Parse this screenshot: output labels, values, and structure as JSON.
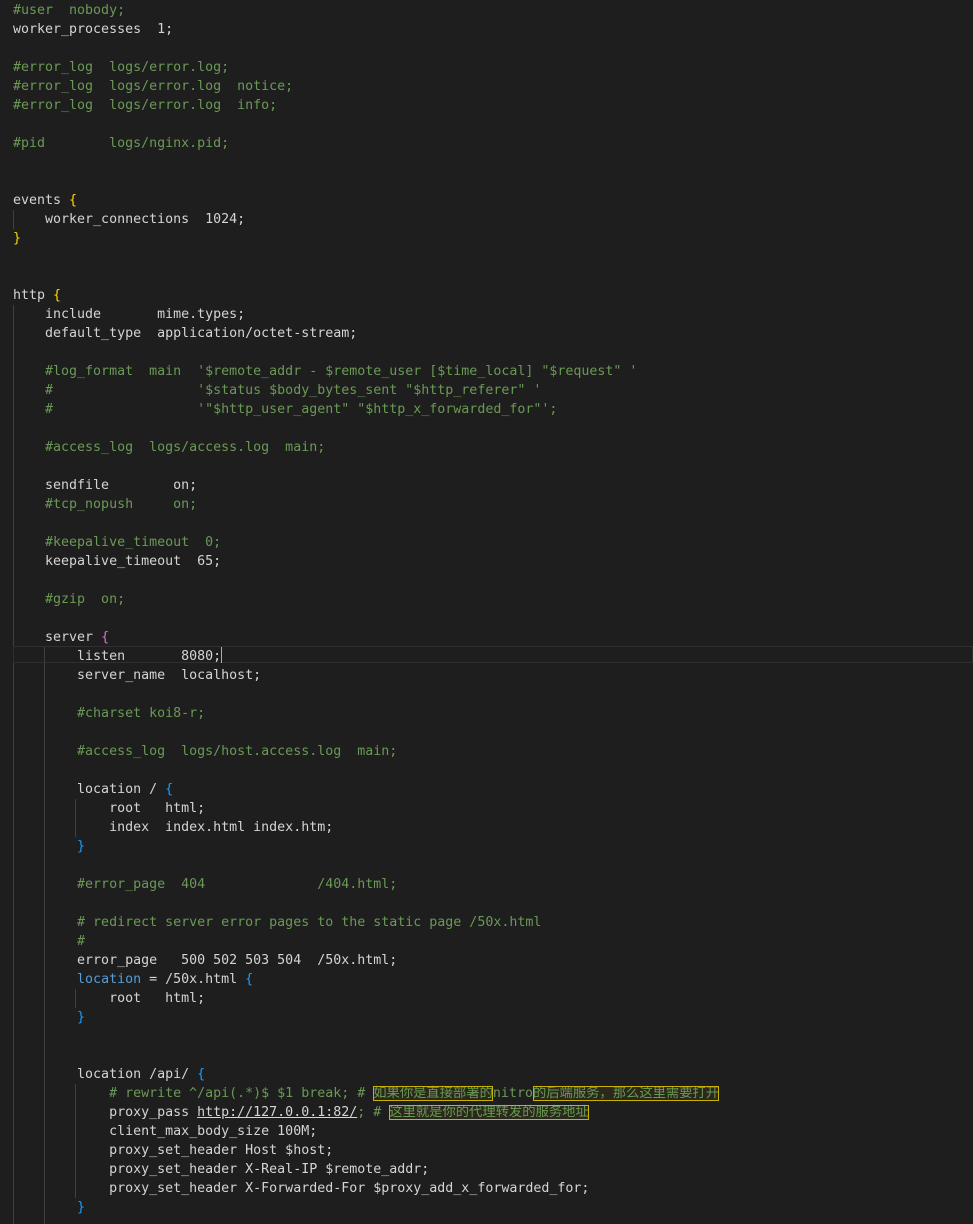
{
  "lines": {
    "l1": "#user  nobody;",
    "l2": "worker_processes  1;",
    "l4": "#error_log  logs/error.log;",
    "l5": "#error_log  logs/error.log  notice;",
    "l6": "#error_log  logs/error.log  info;",
    "l8": "#pid        logs/nginx.pid;",
    "l11a": "events ",
    "l11b": "{",
    "l12": "    worker_connections  1024;",
    "l13": "}",
    "l16a": "http ",
    "l16b": "{",
    "l17": "    include       mime.types;",
    "l18": "    default_type  application/octet-stream;",
    "l20": "    #log_format  main  '$remote_addr - $remote_user [$time_local] \"$request\" '",
    "l21": "    #                  '$status $body_bytes_sent \"$http_referer\" '",
    "l22": "    #                  '\"$http_user_agent\" \"$http_x_forwarded_for\"';",
    "l24": "    #access_log  logs/access.log  main;",
    "l26": "    sendfile        on;",
    "l27": "    #tcp_nopush     on;",
    "l29": "    #keepalive_timeout  0;",
    "l30": "    keepalive_timeout  65;",
    "l32": "    #gzip  on;",
    "l34a": "    server ",
    "l34b": "{",
    "l35a": "        listen       8080;",
    "l36": "        server_name  localhost;",
    "l38": "        #charset koi8-r;",
    "l40": "        #access_log  logs/host.access.log  main;",
    "l42a": "        location / ",
    "l42b": "{",
    "l43": "            root   html;",
    "l44": "            index  index.html index.htm;",
    "l45a": "        ",
    "l45b": "}",
    "l47": "        #error_page  404              /404.html;",
    "l49": "        # redirect server error pages to the static page /50x.html",
    "l50": "        #",
    "l51": "        error_page   500 502 503 504  /50x.html;",
    "l52a": "        ",
    "l52kw": "location",
    "l52b": " = /50x.html ",
    "l52c": "{",
    "l53": "            root   html;",
    "l54a": "        ",
    "l54b": "}",
    "l57a": "        location /api/ ",
    "l57b": "{",
    "l58a": "            # rewrite ^/api(.*)$ $1 break; # ",
    "l58h1": "如果你是直接部署的",
    "l58h2": "nitro",
    "l58h3": "的后端服务，那么这里需要打开",
    "l59a": "            proxy_pass ",
    "l59url": "http://127.0.0.1:82/",
    "l59b": "; # ",
    "l59h": "这里就是你的代理转发的服务地址",
    "l60": "            client_max_body_size 100M;",
    "l61": "            proxy_set_header Host $host;",
    "l62": "            proxy_set_header X-Real-IP $remote_addr;",
    "l63": "            proxy_set_header X-Forwarded-For $proxy_add_x_forwarded_for;",
    "l64a": "        ",
    "l64b": "}"
  },
  "colors": {
    "background": "#1e1e1e",
    "text": "#d4d4d4",
    "comment": "#6a9955",
    "bracket_level1": "#ffd700",
    "bracket_level2": "#da70d6",
    "bracket_level3": "#179fff",
    "keyword": "#569cd6",
    "find_highlight": "#c8b400"
  }
}
